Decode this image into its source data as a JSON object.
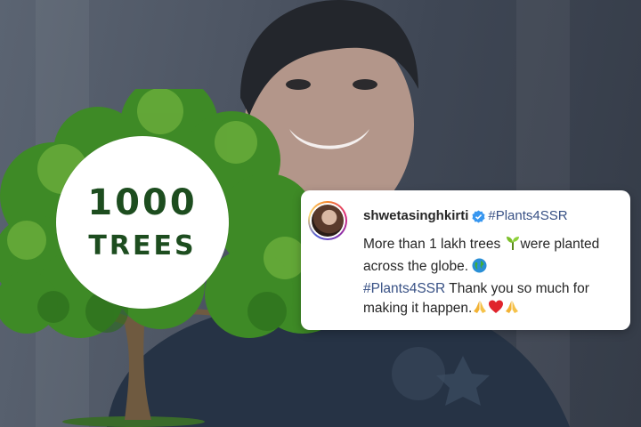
{
  "badge": {
    "number": "1000",
    "word": "TREES"
  },
  "post": {
    "username": "shwetasinghkirti",
    "header_hashtag": "#Plants4SSR",
    "line1": "More than 1 lakh trees ",
    "line2": "were planted across the globe. ",
    "hashtag": "#Plants4SSR",
    "line3": " Thank you so much for making it happen.",
    "emojis": [
      "seedling-emoji",
      "globe-emoji",
      "folded-hands-emoji",
      "red-heart-emoji",
      "folded-hands-emoji"
    ]
  },
  "colors": {
    "tree_text": "#1d4d1f",
    "hashtag": "#385185",
    "verified": "#3897f0",
    "foliage": "#3e8a26"
  }
}
